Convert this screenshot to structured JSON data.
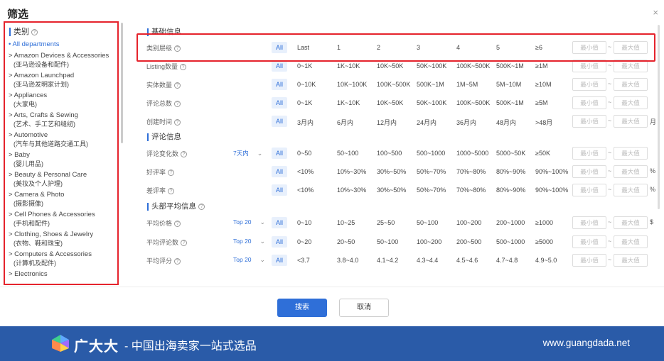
{
  "dialog": {
    "title": "筛选",
    "close": "×"
  },
  "category": {
    "heading": "类别",
    "all_label": "• All departments",
    "items": [
      {
        "en": "> Amazon Devices & Accessories",
        "zh": "(亚马逊设备和配件)"
      },
      {
        "en": "> Amazon Launchpad",
        "zh": "(亚马逊发明家计划)"
      },
      {
        "en": "> Appliances",
        "zh": "(大家电)"
      },
      {
        "en": "> Arts, Crafts & Sewing",
        "zh": "(艺术、手工艺和缝纫)"
      },
      {
        "en": "> Automotive",
        "zh": "(汽车与其他道路交通工具)"
      },
      {
        "en": "> Baby",
        "zh": "(婴儿用品)"
      },
      {
        "en": "> Beauty & Personal Care",
        "zh": "(美妆及个人护理)"
      },
      {
        "en": "> Camera & Photo",
        "zh": "(摄影摄像)"
      },
      {
        "en": "> Cell Phones & Accessories",
        "zh": "(手机和配件)"
      },
      {
        "en": "> Clothing, Shoes & Jewelry",
        "zh": "(衣物、鞋和珠宝)"
      },
      {
        "en": "> Computers & Accessories",
        "zh": "(计算机及配件)"
      },
      {
        "en": "> Electronics",
        "zh": ""
      }
    ]
  },
  "sections": {
    "basic": "基础信息",
    "review": "评论信息",
    "head_avg": "头部平均信息"
  },
  "common": {
    "all": "All",
    "min": "最小值",
    "max": "最大值",
    "tilde": "~"
  },
  "rows": {
    "level": {
      "label": "类别层级",
      "options": [
        "Last",
        "1",
        "2",
        "3",
        "4",
        "5",
        "≥6"
      ]
    },
    "listing": {
      "label": "Listing数量",
      "options": [
        "0~1K",
        "1K~10K",
        "10K~50K",
        "50K~100K",
        "100K~500K",
        "500K~1M",
        "≥1M"
      ]
    },
    "entity": {
      "label": "实体数量",
      "options": [
        "0~10K",
        "10K~100K",
        "100K~500K",
        "500K~1M",
        "1M~5M",
        "5M~10M",
        "≥10M"
      ]
    },
    "reviews_total": {
      "label": "评论总数",
      "options": [
        "0~1K",
        "1K~10K",
        "10K~50K",
        "50K~100K",
        "100K~500K",
        "500K~1M",
        "≥5M"
      ]
    },
    "created": {
      "label": "创建时间",
      "options": [
        "3月内",
        "6月内",
        "12月内",
        "24月内",
        "36月内",
        "48月内",
        ">48月"
      ],
      "suffix": "月"
    },
    "review_change": {
      "label": "评论变化数",
      "period": "7天内",
      "options": [
        "0~50",
        "50~100",
        "100~500",
        "500~1000",
        "1000~5000",
        "5000~50K",
        "≥50K"
      ]
    },
    "good_rate": {
      "label": "好评率",
      "options": [
        "<10%",
        "10%~30%",
        "30%~50%",
        "50%~70%",
        "70%~80%",
        "80%~90%",
        "90%~100%"
      ],
      "suffix": "%"
    },
    "bad_rate": {
      "label": "差评率",
      "options": [
        "<10%",
        "10%~30%",
        "30%~50%",
        "50%~70%",
        "70%~80%",
        "80%~90%",
        "90%~100%"
      ],
      "suffix": "%"
    },
    "avg_price": {
      "label": "平均价格",
      "period": "Top 20",
      "options": [
        "0~10",
        "10~25",
        "25~50",
        "50~100",
        "100~200",
        "200~1000",
        "≥1000"
      ],
      "suffix": "$"
    },
    "avg_reviews": {
      "label": "平均评论数",
      "period": "Top 20",
      "options": [
        "0~20",
        "20~50",
        "50~100",
        "100~200",
        "200~500",
        "500~1000",
        "≥5000"
      ]
    },
    "avg_rating": {
      "label": "平均评分",
      "period": "Top 20",
      "options": [
        "<3.7",
        "3.8~4.0",
        "4.1~4.2",
        "4.3~4.4",
        "4.5~4.6",
        "4.7~4.8",
        "4.9~5.0"
      ]
    }
  },
  "footer": {
    "search": "搜索",
    "cancel": "取消"
  },
  "banner": {
    "brand": "广大大",
    "slogan": "- 中国出海卖家一站式选品",
    "site": "www.guangdada.net"
  },
  "colors": {
    "accent": "#2f6fd8",
    "highlight": "#e5232c",
    "banner": "#2a5ba8"
  }
}
